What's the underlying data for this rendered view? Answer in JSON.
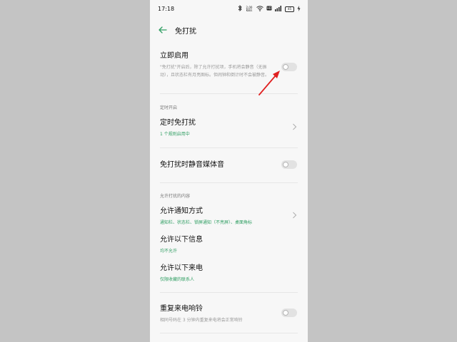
{
  "status_bar": {
    "time": "17:18",
    "network_speed": "2.00 KB/s",
    "icons": [
      "bluetooth-icon",
      "network-speed-icon",
      "wifi-icon",
      "hd-icon",
      "signal-icon",
      "battery-icon",
      "charging-icon"
    ],
    "battery": "45"
  },
  "header": {
    "title": "免打扰",
    "back_icon": "back-arrow-icon"
  },
  "enable_now": {
    "title": "立即启用",
    "description": "\"免打扰\"开启后，除了允许打扰项，手机将会静音（无振动），且状态栏有月亮图标。但闹钟和倒计时不会被静音。",
    "enabled": false
  },
  "scheduled_section": {
    "label": "定时开启",
    "item_title": "定时免打扰",
    "item_sub": "1 个规则启用中"
  },
  "mute_media": {
    "title": "免打扰时静音媒体音",
    "enabled": false
  },
  "allowed_section": {
    "label": "允许打扰的内容",
    "notify": {
      "title": "允许通知方式",
      "sub": "通知栏、状态栏、锁屏通知（不亮屏）、桌面角标"
    },
    "messages": {
      "title": "允许以下信息",
      "sub": "均不允许"
    },
    "calls": {
      "title": "允许以下来电",
      "sub": "仅限收藏的联系人"
    }
  },
  "repeat_calls": {
    "title": "重复来电响铃",
    "description": "相同号码在 3 分钟内重复来电将会正常响铃",
    "enabled": false
  },
  "colors": {
    "accent_green": "#2f9e62",
    "annotation_red": "#e02020"
  }
}
